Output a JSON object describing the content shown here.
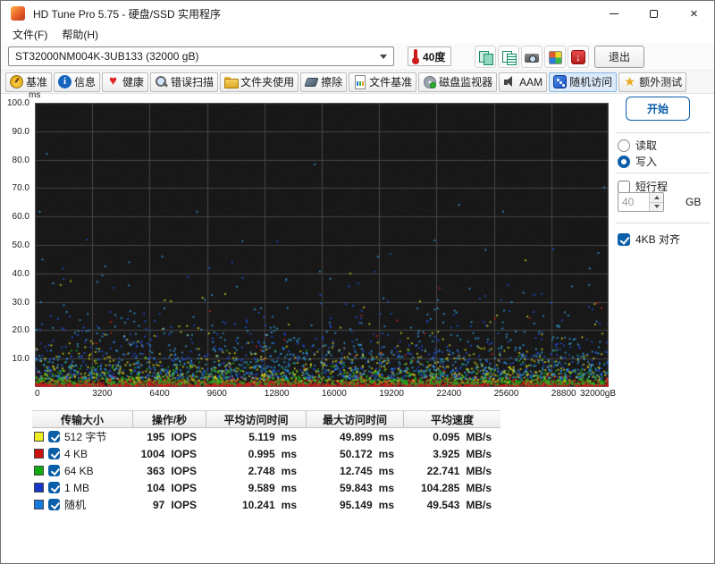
{
  "window": {
    "title": "HD Tune Pro 5.75 - 硬盘/SSD 实用程序"
  },
  "menu": {
    "items": [
      "文件(F)",
      "帮助(H)"
    ]
  },
  "toolbar": {
    "drive_selected": "ST32000NM004K-3UB133 (32000 gB)",
    "temperature": "40度",
    "exit_label": "退出"
  },
  "tabs": [
    {
      "id": "benchmark",
      "icon": "benchmark",
      "label": "基准"
    },
    {
      "id": "info",
      "icon": "info",
      "label": "信息"
    },
    {
      "id": "health",
      "icon": "health",
      "label": "健康"
    },
    {
      "id": "error-scan",
      "icon": "scan",
      "label": "错误扫描"
    },
    {
      "id": "folder-usage",
      "icon": "folder",
      "label": "文件夹使用"
    },
    {
      "id": "erase",
      "icon": "erase",
      "label": "擦除"
    },
    {
      "id": "file-benchmark",
      "icon": "filebench",
      "label": "文件基准"
    },
    {
      "id": "disk-monitor",
      "icon": "monitor",
      "label": "磁盘监视器"
    },
    {
      "id": "aam",
      "icon": "aam",
      "label": "AAM"
    },
    {
      "id": "random-access",
      "icon": "random",
      "label": "随机访问",
      "active": true
    },
    {
      "id": "extra-tests",
      "icon": "extra",
      "label": "额外测试"
    }
  ],
  "panel": {
    "start_label": "开始",
    "mode_read": "读取",
    "mode_write": "写入",
    "selected_mode": "写入",
    "short_stroke_label": "短行程",
    "short_stroke_checked": false,
    "short_stroke_value": "40",
    "short_stroke_unit": "GB",
    "align_label": "4KB 对齐",
    "align_checked": true
  },
  "chart_data": {
    "type": "scatter",
    "ylabel": "ms",
    "ylim": [
      0,
      100
    ],
    "xlim_gb": [
      0,
      32000
    ],
    "grid": true,
    "background": "#181818",
    "y_ticks": [
      "100.0",
      "90.0",
      "80.0",
      "70.0",
      "60.0",
      "50.0",
      "40.0",
      "30.0",
      "20.0",
      "10.0"
    ],
    "x_ticks": [
      "0",
      "3200",
      "6400",
      "9600",
      "12800",
      "16000",
      "19200",
      "22400",
      "25600",
      "28800",
      "32000gB"
    ],
    "series": [
      {
        "name": "512 字节",
        "color": "#d8d820",
        "avg_ms": 5.119,
        "max_ms": 49.899,
        "points": 900
      },
      {
        "name": "4 KB",
        "color": "#d02020",
        "avg_ms": 0.995,
        "max_ms": 50.172,
        "points": 1600
      },
      {
        "name": "64 KB",
        "color": "#20b020",
        "avg_ms": 2.748,
        "max_ms": 12.745,
        "points": 900
      },
      {
        "name": "1 MB",
        "color": "#2050e0",
        "avg_ms": 9.589,
        "max_ms": 59.843,
        "points": 700
      },
      {
        "name": "随机",
        "color": "#30a0e0",
        "avg_ms": 10.241,
        "max_ms": 95.149,
        "points": 700
      }
    ]
  },
  "table": {
    "headers": [
      "传输大小",
      "操作/秒",
      "平均访问时间",
      "最大访问时间",
      "平均速度"
    ],
    "rows": [
      {
        "color": "#f0ee20",
        "checked": true,
        "label": "512 字节",
        "ops": "195",
        "ops_unit": "IOPS",
        "avg": "5.119",
        "avg_unit": "ms",
        "max": "49.899",
        "max_unit": "ms",
        "speed": "0.095",
        "speed_unit": "MB/s"
      },
      {
        "color": "#cc1111",
        "checked": true,
        "label": "4 KB",
        "ops": "1004",
        "ops_unit": "IOPS",
        "avg": "0.995",
        "avg_unit": "ms",
        "max": "50.172",
        "max_unit": "ms",
        "speed": "3.925",
        "speed_unit": "MB/s"
      },
      {
        "color": "#11aa11",
        "checked": true,
        "label": "64 KB",
        "ops": "363",
        "ops_unit": "IOPS",
        "avg": "2.748",
        "avg_unit": "ms",
        "max": "12.745",
        "max_unit": "ms",
        "speed": "22.741",
        "speed_unit": "MB/s"
      },
      {
        "color": "#1538c8",
        "checked": true,
        "label": "1 MB",
        "ops": "104",
        "ops_unit": "IOPS",
        "avg": "9.589",
        "avg_unit": "ms",
        "max": "59.843",
        "max_unit": "ms",
        "speed": "104.285",
        "speed_unit": "MB/s"
      },
      {
        "color": "#1879e0",
        "checked": true,
        "label": "随机",
        "ops": "97",
        "ops_unit": "IOPS",
        "avg": "10.241",
        "avg_unit": "ms",
        "max": "95.149",
        "max_unit": "ms",
        "speed": "49.543",
        "speed_unit": "MB/s"
      }
    ]
  }
}
